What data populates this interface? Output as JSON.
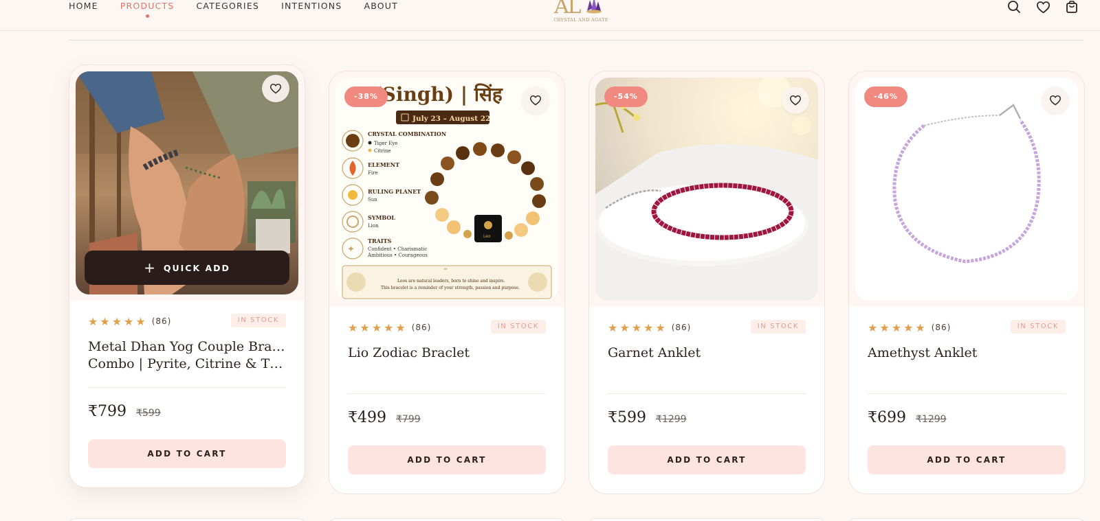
{
  "header": {
    "nav": [
      {
        "label": "HOME",
        "active": false
      },
      {
        "label": "PRODUCTS",
        "active": true
      },
      {
        "label": "CATEGORIES",
        "active": false
      },
      {
        "label": "INTENTIONS",
        "active": false
      },
      {
        "label": "ABOUT",
        "active": false
      }
    ],
    "logo": {
      "mark": "AL",
      "sub": "CRYSTAL AND AGATE"
    },
    "icons": [
      "search-icon",
      "heart-icon",
      "shopping-bag-icon"
    ]
  },
  "colors": {
    "accent": "#e0746a",
    "badge": "#f08a80",
    "star": "#e0a04b",
    "cart_button": "#fde4e1",
    "quick_add": "#2a1c1a"
  },
  "quick_add_label": "QUICK ADD",
  "products": [
    {
      "name_lines": [
        "Metal Dhan Yog Couple Bracelet",
        "Combo | Pyrite, Citrine & Tiger..."
      ],
      "rating": 5,
      "reviews": "(86)",
      "stock": "IN STOCK",
      "price": "₹799",
      "old_price": "₹599",
      "badge": "",
      "cart_label": "ADD TO CART",
      "image": "couple-bracelet-photo"
    },
    {
      "name_lines": [
        "Lio Zodiac Braclet"
      ],
      "rating": 5,
      "reviews": "(86)",
      "stock": "IN STOCK",
      "price": "₹499",
      "old_price": "₹799",
      "badge": "-38%",
      "cart_label": "ADD TO CART",
      "image": "leo-zodiac-infographic",
      "image_text": {
        "heading": "o (Singh) | सिंह",
        "dates": "July 23 – August 22",
        "info": [
          {
            "title": "CRYSTAL COMBINATION",
            "lines": [
              "Tiger Eye",
              "Citrine"
            ]
          },
          {
            "title": "ELEMENT",
            "lines": [
              "Fire"
            ]
          },
          {
            "title": "RULING PLANET",
            "lines": [
              "Sun"
            ]
          },
          {
            "title": "SYMBOL",
            "lines": [
              "Lion"
            ]
          },
          {
            "title": "TRAITS",
            "lines": [
              "Confident • Charismatic",
              "Ambitious • Courageous"
            ]
          }
        ],
        "bead_label": "Leo",
        "quote_1": "Leos are natural leaders, born to shine and inspire.",
        "quote_2": "This bracelet is a reminder of your strength, passion and purpose."
      }
    },
    {
      "name_lines": [
        "Garnet Anklet"
      ],
      "rating": 5,
      "reviews": "(86)",
      "stock": "IN STOCK",
      "price": "₹599",
      "old_price": "₹1299",
      "badge": "-54%",
      "cart_label": "ADD TO CART",
      "image": "garnet-anklet-photo"
    },
    {
      "name_lines": [
        "Amethyst Anklet"
      ],
      "rating": 5,
      "reviews": "(86)",
      "stock": "IN STOCK",
      "price": "₹699",
      "old_price": "₹1299",
      "badge": "-46%",
      "cart_label": "ADD TO CART",
      "image": "amethyst-anklet-photo"
    }
  ]
}
